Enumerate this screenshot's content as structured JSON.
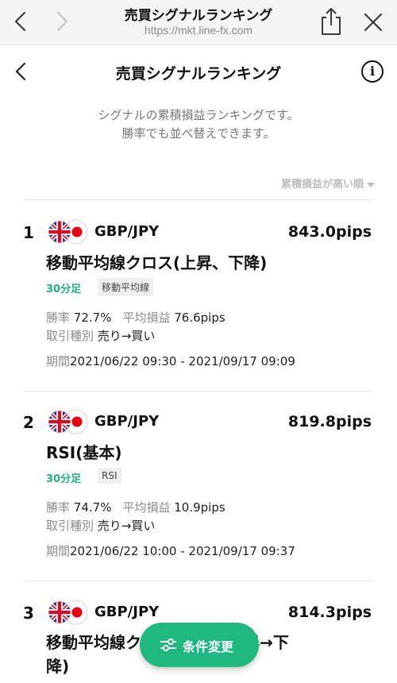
{
  "browser": {
    "title": "売買シグナルランキング",
    "url": "https://mkt.line-fx.com"
  },
  "header": {
    "title": "売買シグナルランキング",
    "info_icon": "i"
  },
  "description": {
    "line1": "シグナルの累積損益ランキングです。",
    "line2": "勝率でも並べ替えできます。"
  },
  "sort": {
    "label": "累積損益が高い順"
  },
  "labels": {
    "win_rate": "勝率",
    "avg_pl": "平均損益",
    "trade_type": "取引種別",
    "period": "期間"
  },
  "rankings": [
    {
      "rank": "1",
      "pair": "GBP/JPY",
      "pips": "843.0pips",
      "name": "移動平均線クロス(上昇、下降)",
      "timeframe": "30分足",
      "tag": "移動平均線",
      "win_rate": "72.7%",
      "avg_pl": "76.6pips",
      "trade_type": "売り→買い",
      "period": "2021/06/22 09:30 - 2021/09/17 09:09"
    },
    {
      "rank": "2",
      "pair": "GBP/JPY",
      "pips": "819.8pips",
      "name": "RSI(基本)",
      "timeframe": "30分足",
      "tag": "RSI",
      "win_rate": "74.7%",
      "avg_pl": "10.9pips",
      "trade_type": "売り→買い",
      "period": "2021/06/22 10:00 - 2021/09/17 09:37"
    },
    {
      "rank": "3",
      "pair": "GBP/JPY",
      "pips": "814.3pips",
      "name_line1": "移動平均線クロス(下降、上昇→下",
      "name_line2": "降)"
    }
  ],
  "fab": {
    "label": "条件変更",
    "icon": "sliders-icon"
  },
  "colors": {
    "accent": "#1db37a",
    "fab": "#1fb980",
    "muted": "#8c8c8c"
  }
}
